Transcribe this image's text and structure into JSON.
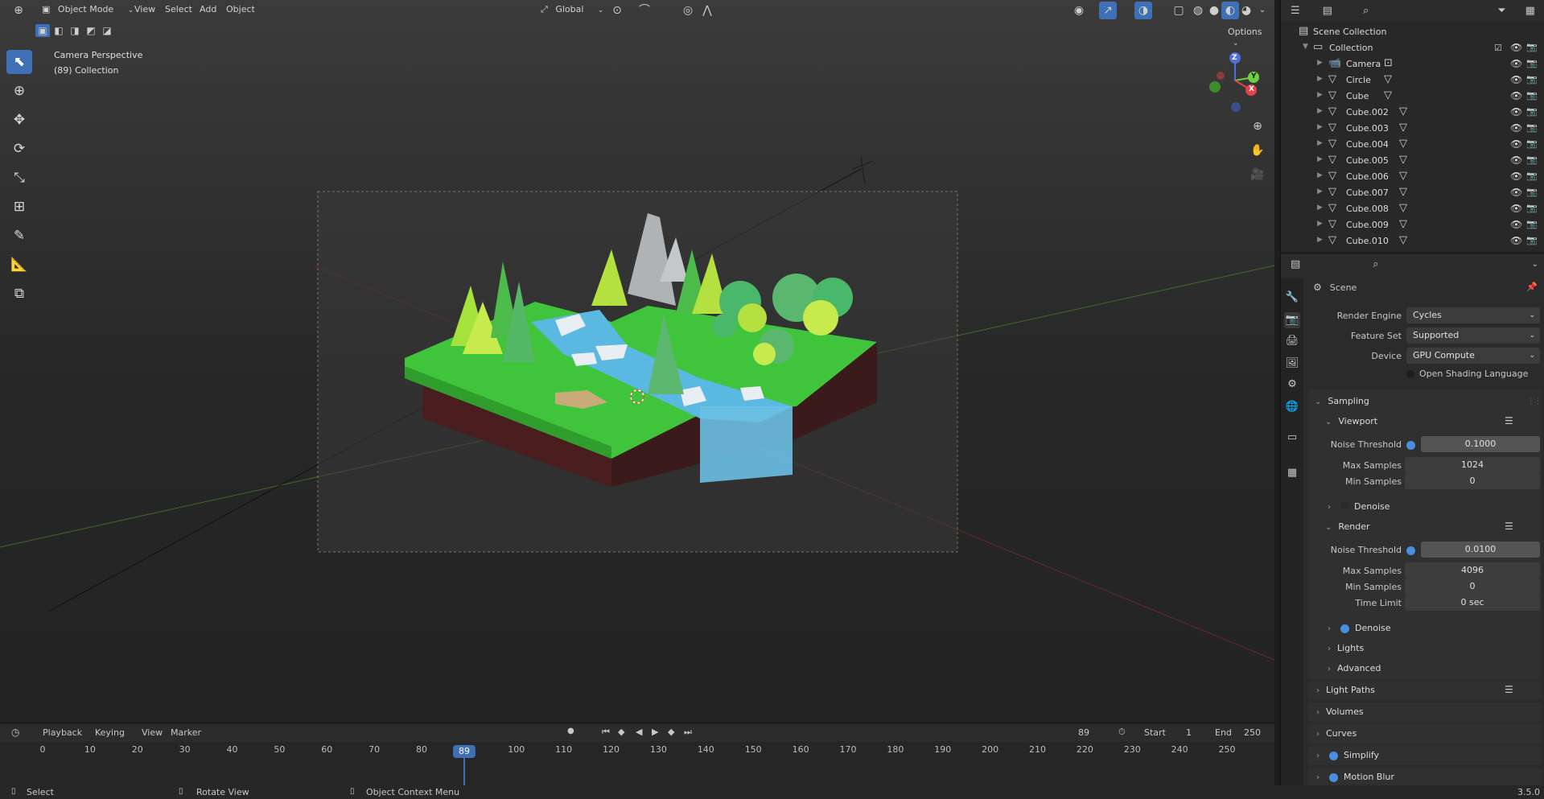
{
  "viewport_header": {
    "mode": "Object Mode",
    "menus": [
      "View",
      "Select",
      "Add",
      "Object"
    ],
    "transform_orientation": "Global",
    "options_label": "Options"
  },
  "viewport_overlay": {
    "camera_label": "Camera Perspective",
    "collection_label": "(89) Collection"
  },
  "gizmo": {
    "z": "Z",
    "y": "Y",
    "x": "X"
  },
  "outliner": {
    "root": "Scene Collection",
    "collection": "Collection",
    "items": [
      "Camera",
      "Circle",
      "Cube",
      "Cube.002",
      "Cube.003",
      "Cube.004",
      "Cube.005",
      "Cube.006",
      "Cube.007",
      "Cube.008",
      "Cube.009",
      "Cube.010"
    ]
  },
  "properties": {
    "context": "Scene",
    "render_engine_label": "Render Engine",
    "render_engine": "Cycles",
    "feature_set_label": "Feature Set",
    "feature_set": "Supported",
    "device_label": "Device",
    "device": "GPU Compute",
    "osl_label": "Open Shading Language",
    "sampling": "Sampling",
    "viewport": {
      "title": "Viewport",
      "noise_threshold_label": "Noise Threshold",
      "noise_threshold": "0.1000",
      "max_samples_label": "Max Samples",
      "max_samples": "1024",
      "min_samples_label": "Min Samples",
      "min_samples": "0",
      "denoise": "Denoise"
    },
    "render": {
      "title": "Render",
      "noise_threshold_label": "Noise Threshold",
      "noise_threshold": "0.0100",
      "max_samples_label": "Max Samples",
      "max_samples": "4096",
      "min_samples_label": "Min Samples",
      "min_samples": "0",
      "time_limit_label": "Time Limit",
      "time_limit": "0 sec",
      "denoise": "Denoise"
    },
    "lights": "Lights",
    "advanced": "Advanced",
    "light_paths": "Light Paths",
    "volumes": "Volumes",
    "curves": "Curves",
    "simplify": "Simplify",
    "motion_blur": "Motion Blur"
  },
  "timeline": {
    "menus": [
      "Playback",
      "Keying",
      "View",
      "Marker"
    ],
    "current_frame": "89",
    "start_label": "Start",
    "start": "1",
    "end_label": "End",
    "end": "250",
    "ticks": [
      "0",
      "10",
      "20",
      "30",
      "40",
      "50",
      "60",
      "70",
      "80",
      "100",
      "110",
      "120",
      "130",
      "140",
      "150",
      "160",
      "170",
      "180",
      "190",
      "200",
      "210",
      "220",
      "230",
      "240",
      "250"
    ]
  },
  "statusbar": {
    "select": "Select",
    "rotate_view": "Rotate View",
    "context_menu": "Object Context Menu",
    "version": "3.5.0"
  },
  "colors": {
    "accent": "#3f6fb4",
    "grass": "#3fc43b",
    "water": "#5bb8e0",
    "x_axis": "#e0434b",
    "y_axis": "#6ccf3c",
    "z_axis": "#4f6fe0"
  }
}
